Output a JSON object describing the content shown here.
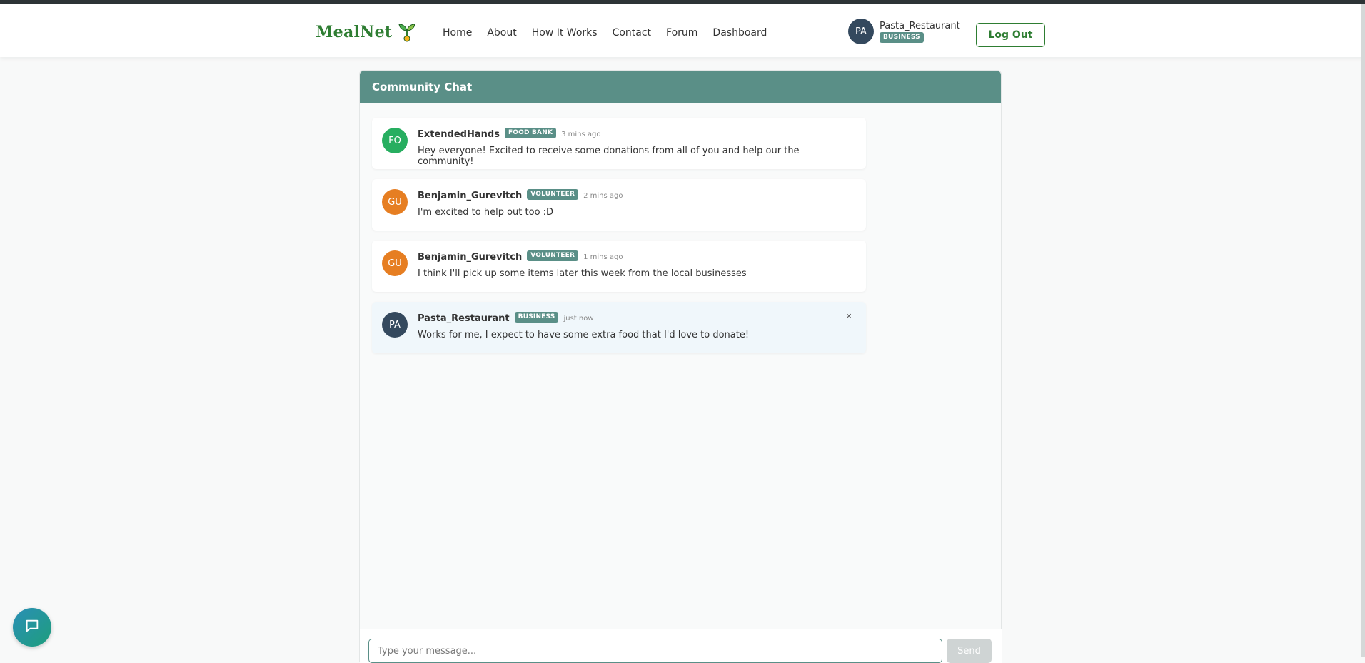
{
  "brand": {
    "name": "MealNet"
  },
  "nav": {
    "items": [
      "Home",
      "About",
      "How It Works",
      "Contact",
      "Forum",
      "Dashboard"
    ]
  },
  "user": {
    "initials": "PA",
    "name": "Pasta_Restaurant",
    "role": "BUSINESS",
    "avatar_color": "#34495e"
  },
  "logout_label": "Log Out",
  "chat": {
    "title": "Community Chat",
    "messages": [
      {
        "initials": "FO",
        "avatar_color": "#27ae60",
        "user": "ExtendedHands",
        "role": "FOOD BANK",
        "time": "3 mins ago",
        "text": "Hey everyone! Excited to receive some donations from all of you and help our the community!"
      },
      {
        "initials": "GU",
        "avatar_color": "#e67e22",
        "user": "Benjamin_Gurevitch",
        "role": "VOLUNTEER",
        "time": "2 mins ago",
        "text": "I'm excited to help out too :D"
      },
      {
        "initials": "GU",
        "avatar_color": "#e67e22",
        "user": "Benjamin_Gurevitch",
        "role": "VOLUNTEER",
        "time": "1 mins ago",
        "text": "I think I'll pick up some items later this week from the local businesses"
      },
      {
        "initials": "PA",
        "avatar_color": "#34495e",
        "user": "Pasta_Restaurant",
        "role": "BUSINESS",
        "time": "just now",
        "text": "Works for me, I expect to have some extra food that I'd love to donate!",
        "delete_label": "×"
      }
    ],
    "input_placeholder": "Type your message...",
    "send_label": "Send"
  },
  "colors": {
    "accent": "#5a8f87",
    "brand_green": "#2e7d32"
  }
}
